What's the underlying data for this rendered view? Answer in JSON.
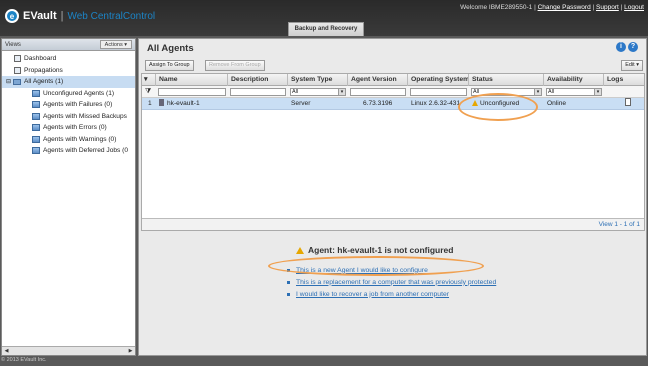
{
  "header": {
    "brand": "EVault",
    "separator": "|",
    "product": "Web CentralControl",
    "logo_letter": "e",
    "welcome_text": "Welcome IBME289550-1 |",
    "links": [
      "Change Password",
      "Support",
      "Logout"
    ],
    "active_tab": "Backup and Recovery"
  },
  "sidebar": {
    "title": "Views",
    "actions_label": "Actions ▾",
    "items": [
      {
        "label": "Dashboard"
      },
      {
        "label": "Propagations"
      },
      {
        "label": "All Agents (1)"
      },
      {
        "label": "Unconfigured Agents (1)"
      },
      {
        "label": "Agents with Failures (0)"
      },
      {
        "label": "Agents with Missed Backups"
      },
      {
        "label": "Agents with Errors (0)"
      },
      {
        "label": "Agents with Warnings (0)"
      },
      {
        "label": "Agents with Deferred Jobs (0"
      }
    ]
  },
  "main": {
    "title": "All Agents",
    "toolbar": {
      "assign": "Assign To Group",
      "remove": "Remove From Group",
      "edit": "Edit ▾"
    },
    "columns": [
      "Name",
      "Description",
      "System Type",
      "Agent Version",
      "Operating System",
      "Status",
      "Availability",
      "Logs"
    ],
    "filters": {
      "system_type": "All",
      "status": "All",
      "availability": "All"
    },
    "rows": [
      {
        "num": "1",
        "name": "hk-evault-1",
        "description": "",
        "system_type": "Server",
        "agent_version": "6.73.3196",
        "os": "Linux 2.6.32-431",
        "status": "Unconfigured",
        "availability": "Online"
      }
    ],
    "view_count": "View 1 - 1 of 1"
  },
  "notice": {
    "title": "Agent: hk-evault-1 is not configured",
    "links": [
      "This is a new Agent I would like to configure",
      "This is a replacement for a computer that was previously protected",
      "I would like to recover a job from another computer"
    ]
  },
  "footer": "© 2013 EVault Inc.",
  "colors": {
    "accent": "#1c84c6",
    "highlight_ring": "#f0a050",
    "selected_row": "#c9def4",
    "link": "#2c6fb4"
  }
}
